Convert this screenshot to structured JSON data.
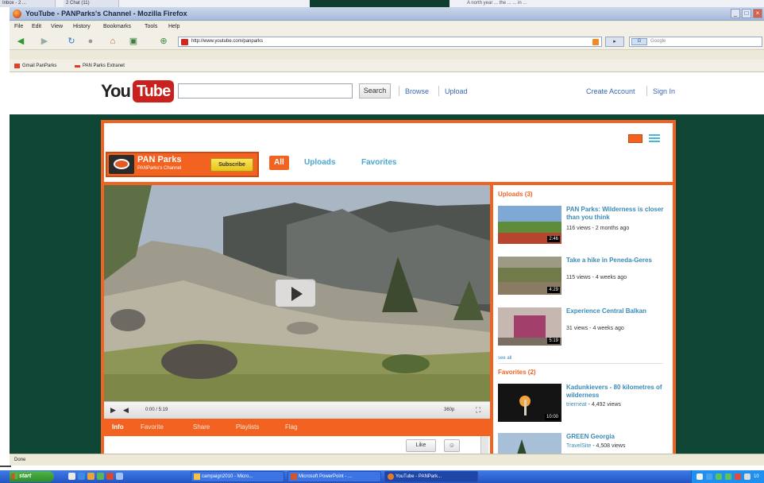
{
  "background_window": {
    "tabs": [
      "Inbox - 2 ...",
      "2 Chat (11)"
    ],
    "text": "A north year ... the ... ... in ..."
  },
  "window": {
    "title": "YouTube - PANParks's Channel - Mozilla Firefox",
    "buttons": [
      "_",
      "□",
      "×"
    ]
  },
  "menu": [
    "File",
    "Edit",
    "View",
    "History",
    "Bookmarks",
    "Tools",
    "Help"
  ],
  "navigation": {
    "url": "http://www.youtube.com/panparks",
    "search_placeholder": "Google",
    "search_engine": "G"
  },
  "bookmarks": [
    "Gmail PanParks",
    "PAN Parks Extranet"
  ],
  "youtube": {
    "logo_you": "You",
    "logo_tube": "Tube",
    "search_button": "Search",
    "links": [
      "Browse",
      "Upload"
    ],
    "account_links": [
      "Create Account",
      "Sign In"
    ]
  },
  "channel": {
    "name": "PAN Parks",
    "subtitle": "PANParks's Channel",
    "subscribe_label": "Subscribe",
    "tabs": [
      {
        "label": "All",
        "active": true
      },
      {
        "label": "Uploads",
        "active": false
      },
      {
        "label": "Favorites",
        "active": false
      }
    ],
    "accent_color": "#f26322",
    "link_color": "#3a8ab6"
  },
  "player": {
    "time": "0:00 / 5:19",
    "quality": "360p",
    "info_tabs": [
      {
        "label": "Info",
        "active": true
      },
      {
        "label": "Favorite",
        "active": false
      },
      {
        "label": "Share",
        "active": false
      },
      {
        "label": "Playlists",
        "active": false
      },
      {
        "label": "Flag",
        "active": false
      }
    ],
    "like_label": "Like"
  },
  "sidebar": {
    "uploads_heading": "Uploads (3)",
    "uploads": [
      {
        "title": "PAN Parks: Wilderness is closer than you think",
        "meta": "116 views - 2 months ago",
        "duration": "2:46"
      },
      {
        "title": "Take a hike in Peneda-Geres",
        "meta": "115 views - 4 weeks ago",
        "duration": "4:29"
      },
      {
        "title": "Experience Central Balkan",
        "meta": "31 views - 4 weeks ago",
        "duration": "5:19"
      }
    ],
    "see_all": "see all",
    "favorites_heading": "Favorites (2)",
    "favorites": [
      {
        "title": "Kadunkievers - 80 kilometres of wilderness",
        "by": "trierneat",
        "meta": "4,492 views",
        "duration": "10:00"
      },
      {
        "title": "GREEN Georgia",
        "by": "TravelSite",
        "meta": "4,508 views",
        "duration": ""
      }
    ]
  },
  "status": {
    "text": "Done"
  },
  "taskbar": {
    "start_label": "start",
    "tasks": [
      {
        "label": "campaign2010 - Micro...",
        "active": false
      },
      {
        "label": "Microsoft PowerPoint - ...",
        "active": false
      },
      {
        "label": "YouTube - PANPark...",
        "active": true
      }
    ],
    "clock": "10"
  }
}
